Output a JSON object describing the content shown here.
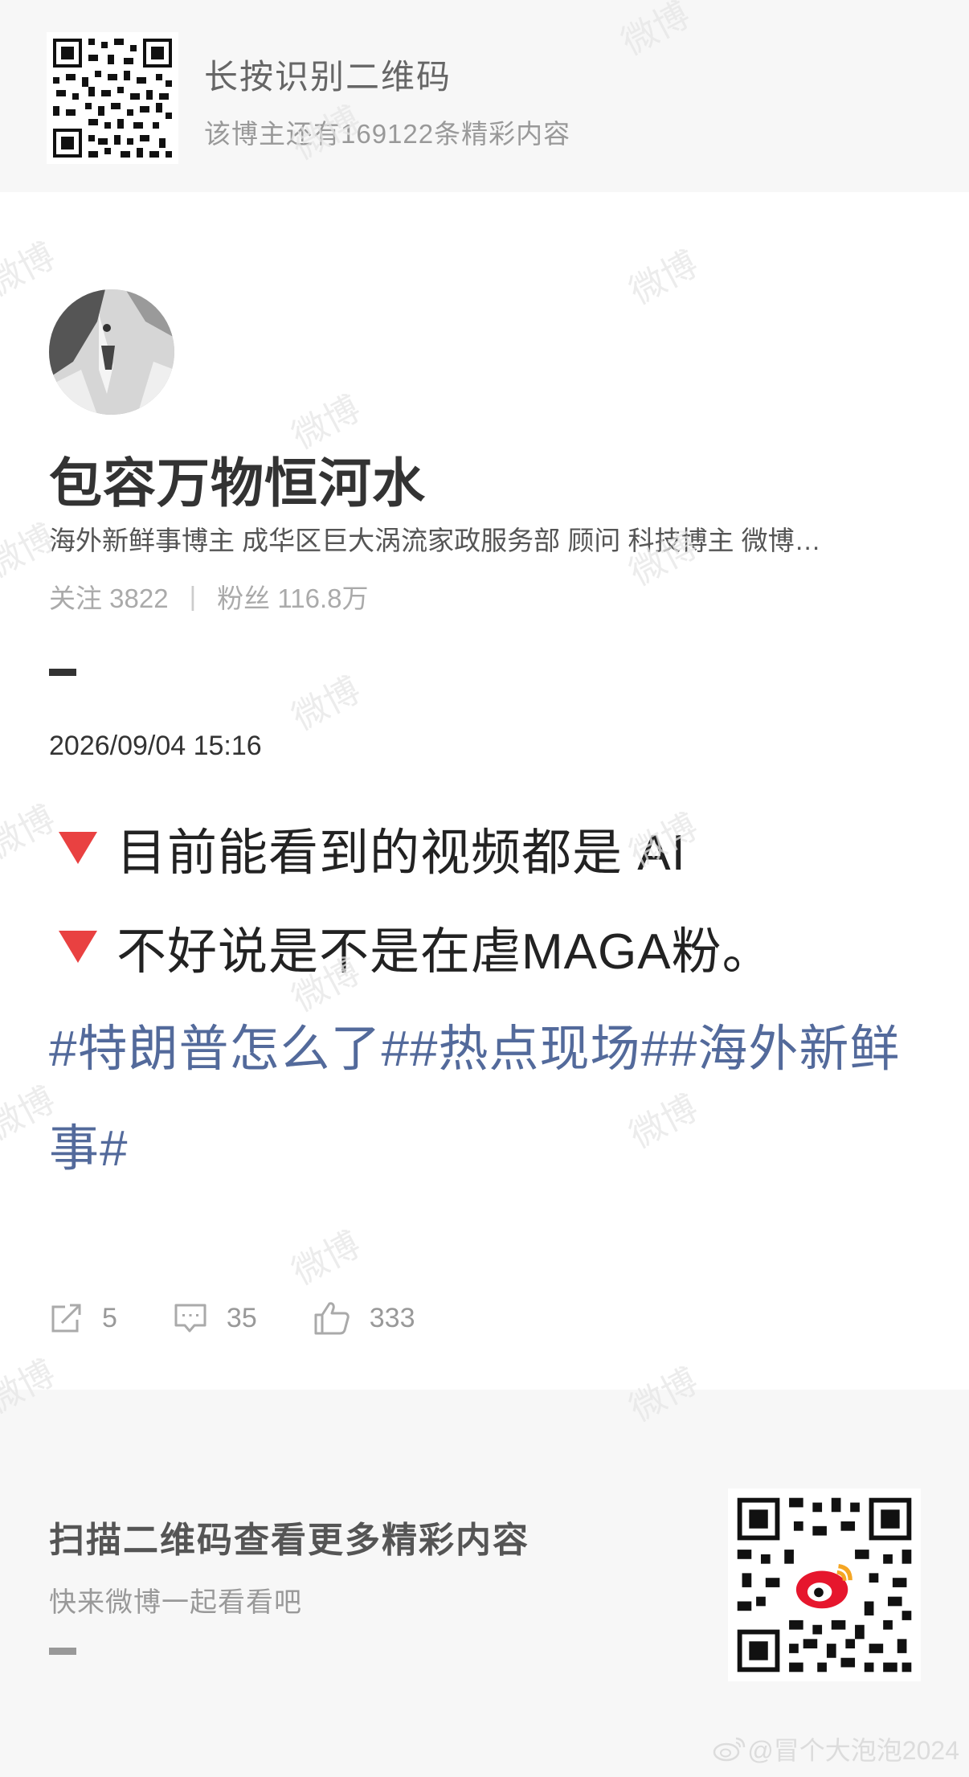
{
  "top_banner": {
    "title": "长按识别二维码",
    "subtitle": "该博主还有169122条精彩内容"
  },
  "profile": {
    "name": "包容万物恒河水",
    "description": "海外新鲜事博主 成华区巨大涡流家政服务部 顾问 科技博主 微博…",
    "following_label": "关注 3822",
    "followers_label": "粉丝 116.8万"
  },
  "post": {
    "time": "2026/09/04 15:16",
    "lines": [
      "目前能看到的视频都是 AI",
      "不好说是不是在虐MAGA粉。"
    ],
    "hashtags": "#特朗普怎么了##热点现场##海外新鲜事#"
  },
  "actions": {
    "repost_count": "5",
    "comment_count": "35",
    "like_count": "333"
  },
  "bottom": {
    "title": "扫描二维码查看更多精彩内容",
    "subtitle": "快来微博一起看看吧"
  },
  "watermark": {
    "text": "微博",
    "footer": "@冒个大泡泡2024"
  },
  "colors": {
    "hashtag": "#536a9b",
    "bullet": "#e94141",
    "banner_bg": "#f7f7f7"
  }
}
